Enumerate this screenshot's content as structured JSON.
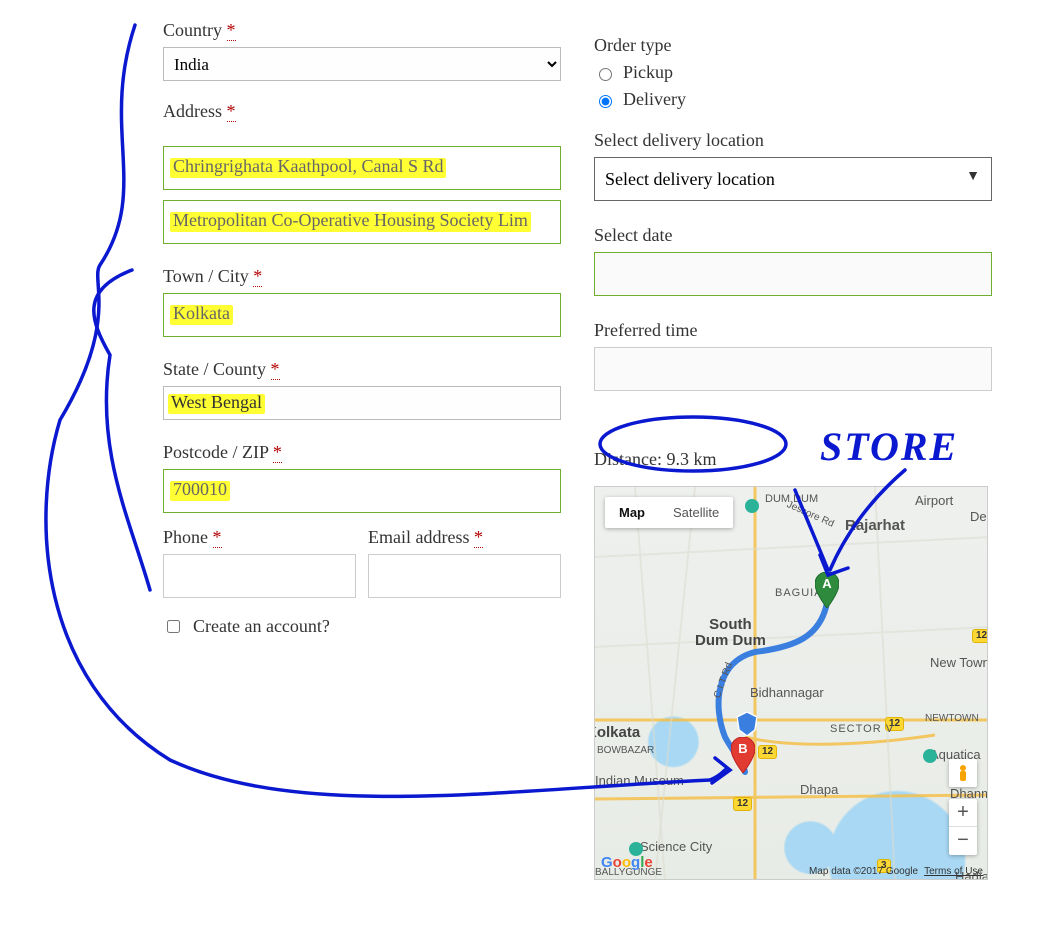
{
  "form": {
    "country_label": "Country",
    "country_value": "India",
    "address_label": "Address",
    "address_line1": "Chringrighata Kaathpool, Canal S Rd",
    "address_line2": "Metropolitan Co-Operative Housing Society Lim",
    "city_label": "Town / City",
    "city_value": "Kolkata",
    "state_label": "State / County",
    "state_value": "West Bengal",
    "postcode_label": "Postcode / ZIP",
    "postcode_value": "700010",
    "phone_label": "Phone",
    "email_label": "Email address",
    "create_account_label": "Create an account?"
  },
  "order": {
    "order_type_label": "Order type",
    "pickup_label": "Pickup",
    "delivery_label": "Delivery",
    "select_location_label": "Select delivery location",
    "select_location_value": "Select delivery location",
    "select_date_label": "Select date",
    "preferred_time_label": "Preferred time",
    "distance_label": "Distance: 9.3 km"
  },
  "map": {
    "map_tab": "Map",
    "satellite_tab": "Satellite",
    "zoom_in": "+",
    "zoom_out": "−",
    "attribution_text": "Map data ©2017 Google",
    "terms": "Terms of Use",
    "labels": {
      "south_dum_dum": "South\nDum Dum",
      "rajarhat": "Rajarhat",
      "airport": "Airport",
      "dum_dum": "DUM DUM",
      "baguati": "BAGUIATI",
      "new_town": "New Town",
      "bidhannagar": "Bidhannagar",
      "sector_v": "SECTOR V",
      "newtown_small": "NEWTOWN",
      "aquatica": "Aquatica",
      "dhapa": "Dhapa",
      "dhanmat": "Dhanmat\nPala",
      "kolkata": "Kolkata",
      "bowbazar": "BOWBAZAR",
      "indian_museum": "Indian Museum",
      "science_city": "Science City",
      "hadia": "Hadia",
      "ballygunge": "BALLYGUNGE",
      "dean": "Dean",
      "citrd": "C.I.T Rd",
      "jessore": "Jessore Rd"
    },
    "road_12": "12",
    "road_3": "3",
    "marker_a": "A",
    "marker_b": "B"
  },
  "annotation": {
    "store": "STORE"
  }
}
